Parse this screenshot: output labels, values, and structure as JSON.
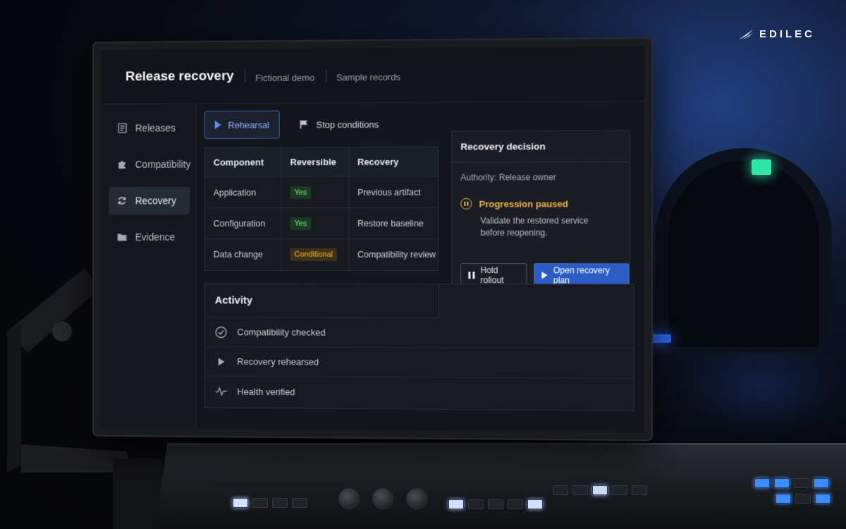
{
  "brand": {
    "name": "EDILEC"
  },
  "app": {
    "title": "Release recovery",
    "chips": [
      "Fictional demo",
      "Sample records"
    ]
  },
  "sidebar": {
    "items": [
      {
        "label": "Releases",
        "icon": "document-icon",
        "active": false
      },
      {
        "label": "Compatibility",
        "icon": "puzzle-icon",
        "active": false
      },
      {
        "label": "Recovery",
        "icon": "refresh-icon",
        "active": true
      },
      {
        "label": "Evidence",
        "icon": "folder-icon",
        "active": false
      }
    ]
  },
  "tabs": [
    {
      "label": "Rehearsal",
      "icon": "play-icon",
      "active": true
    },
    {
      "label": "Stop conditions",
      "icon": "flag-icon",
      "active": false
    }
  ],
  "table": {
    "headers": [
      "Component",
      "Reversible",
      "Recovery"
    ],
    "rows": [
      {
        "component": "Application",
        "reversible": "Yes",
        "recovery": "Previous artifact"
      },
      {
        "component": "Configuration",
        "reversible": "Yes",
        "recovery": "Restore baseline"
      },
      {
        "component": "Data change",
        "reversible": "Conditional",
        "recovery": "Compatibility review"
      }
    ]
  },
  "decision": {
    "title": "Recovery decision",
    "authority": "Authority: Release owner",
    "status": "Progression paused",
    "message": "Validate the restored service before reopening.",
    "hold_label": "Hold rollout",
    "open_label": "Open recovery plan"
  },
  "activity": {
    "title": "Activity",
    "items": [
      {
        "label": "Compatibility checked",
        "icon": "check-circle-icon"
      },
      {
        "label": "Recovery rehearsed",
        "icon": "play-icon"
      },
      {
        "label": "Health verified",
        "icon": "pulse-icon"
      }
    ]
  },
  "colors": {
    "accent": "#2a5cc4",
    "warning": "#f3b14a",
    "success": "#7fe08e",
    "exit_sign": "#2ee6a8"
  }
}
